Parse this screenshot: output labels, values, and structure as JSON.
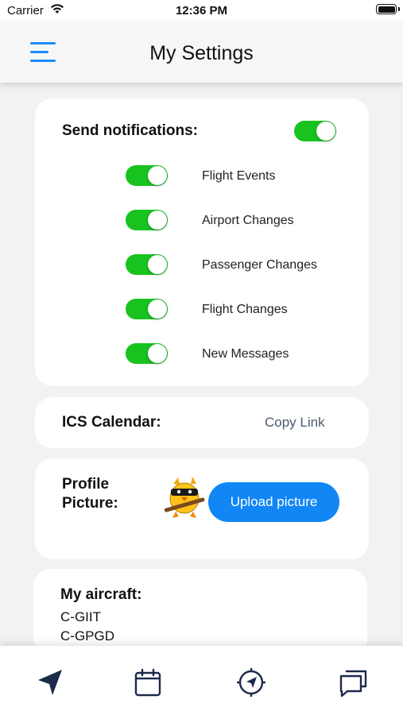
{
  "status_bar": {
    "carrier": "Carrier",
    "time": "12:36 PM"
  },
  "header": {
    "title": "My Settings",
    "menu_icon": "hamburger-menu-icon"
  },
  "notifications": {
    "title": "Send notifications:",
    "enabled": true,
    "items": [
      {
        "label": "Flight Events",
        "enabled": true
      },
      {
        "label": "Airport Changes",
        "enabled": true
      },
      {
        "label": "Passenger Changes",
        "enabled": true
      },
      {
        "label": "Flight Changes",
        "enabled": true
      },
      {
        "label": "New Messages",
        "enabled": true
      }
    ]
  },
  "ics": {
    "label": "ICS Calendar:",
    "action": "Copy Link"
  },
  "profile": {
    "label": "Profile Picture:",
    "upload_label": "Upload picture"
  },
  "aircraft": {
    "title": "My aircraft:",
    "list": [
      "C-GIIT",
      "C-GPGD"
    ]
  },
  "tab_bar": {
    "icons": [
      "navigation-arrow-icon",
      "calendar-icon",
      "compass-icon",
      "chat-icon"
    ]
  },
  "colors": {
    "accent": "#1187f5",
    "toggle_on": "#18c21f",
    "tab_icon": "#1c2a4a"
  }
}
